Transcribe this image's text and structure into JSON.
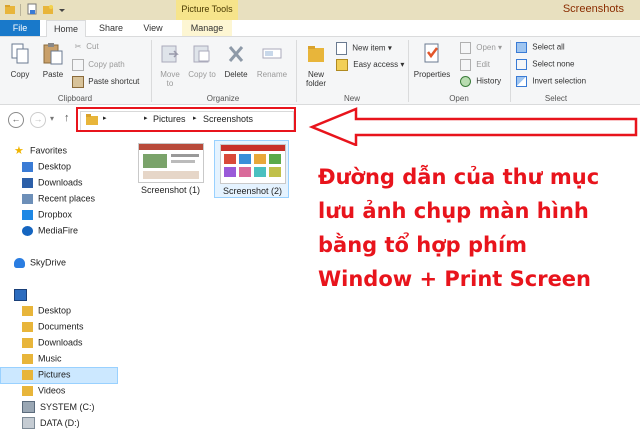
{
  "window": {
    "title": "Screenshots",
    "contextual_tab_group": "Picture Tools"
  },
  "tabs": [
    "File",
    "Home",
    "Share",
    "View",
    "Manage"
  ],
  "ribbon": {
    "clipboard": {
      "group": "Clipboard",
      "copy": "Copy",
      "paste": "Paste",
      "cut": "Cut",
      "copy_path": "Copy path",
      "paste_shortcut": "Paste shortcut"
    },
    "organize": {
      "group": "Organize",
      "move_to": "Move to",
      "copy_to": "Copy to",
      "delete": "Delete",
      "rename": "Rename",
      "to": "to"
    },
    "new": {
      "group": "New",
      "new_folder_1": "New",
      "new_folder_2": "folder",
      "new_item": "New item",
      "easy_access": "Easy access"
    },
    "open": {
      "group": "Open",
      "properties": "Properties",
      "open": "Open",
      "edit": "Edit",
      "history": "History"
    },
    "select": {
      "group": "Select",
      "select_all": "Select all",
      "select_none": "Select none",
      "invert_selection": "Invert selection"
    }
  },
  "address": {
    "crumbs": [
      "Pictures",
      "Screenshots"
    ]
  },
  "nav_pane": {
    "favorites": {
      "header": "Favorites",
      "items": [
        "Desktop",
        "Downloads",
        "Recent places",
        "Dropbox",
        "MediaFire"
      ]
    },
    "skydrive": "SkyDrive",
    "computer": {
      "items": [
        "Desktop",
        "Documents",
        "Downloads",
        "Music",
        "Pictures",
        "Videos",
        "SYSTEM (C:)",
        "DATA (D:)"
      ]
    }
  },
  "files": [
    {
      "name": "Screenshot (1)"
    },
    {
      "name": "Screenshot (2)"
    }
  ],
  "annotation": {
    "lines": [
      "Đường dẫn của thư mục",
      "lưu ảnh chụp màn hình",
      "bằng tổ hợp phím",
      "Window + Print Screen"
    ],
    "color": "#e8141c"
  },
  "colors": {
    "file_tab": "#1979ca",
    "selection": "#cce8ff",
    "annotation_red": "#e8141c",
    "titlebar": "#e8e0bf"
  }
}
